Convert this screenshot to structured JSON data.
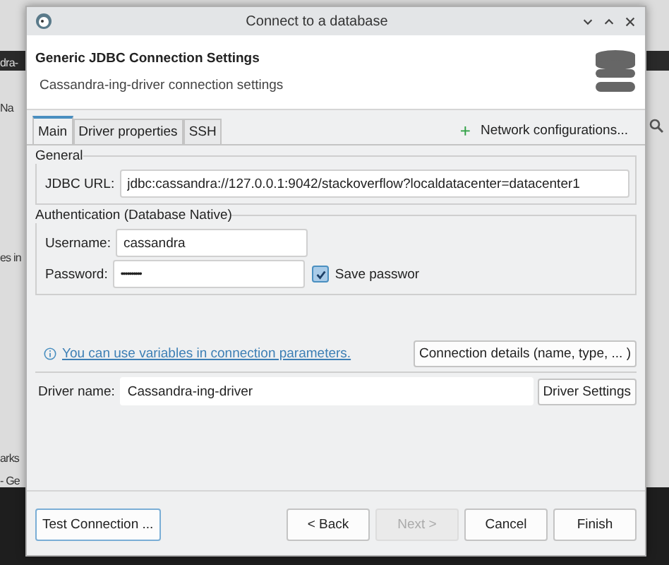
{
  "background": {
    "fragments": [
      {
        "text": "dra-",
        "kind": "dark"
      },
      {
        "text": "Na",
        "kind": "light"
      },
      {
        "text": "es in",
        "kind": "light"
      },
      {
        "text": "arks",
        "kind": "light"
      },
      {
        "text": "- Ge",
        "kind": "light"
      }
    ]
  },
  "window": {
    "title": "Connect to a database"
  },
  "header": {
    "title": "Generic JDBC Connection Settings",
    "subtitle": "Cassandra-ing-driver connection settings"
  },
  "tabs": [
    {
      "label": "Main",
      "selected": true
    },
    {
      "label": "Driver properties",
      "selected": false
    },
    {
      "label": "SSH",
      "selected": false
    }
  ],
  "network_button": {
    "icon": "+",
    "label": "Network configurations..."
  },
  "general": {
    "legend": "General",
    "url_label": "JDBC URL:",
    "url": "jdbc:cassandra://127.0.0.1:9042/stackoverflow?localdatacenter=datacenter1"
  },
  "auth": {
    "legend": "Authentication (Database Native)",
    "username_label": "Username:",
    "username": "cassandra",
    "password_label": "Password:",
    "password": "••••••••••",
    "save_password": {
      "label": "Save passwor",
      "checked": true
    }
  },
  "info_link": "You can use variables in connection parameters.",
  "details_button": "Connection details (name, type, ... )",
  "driver": {
    "label": "Driver name:",
    "value": "Cassandra-ing-driver",
    "button": "Driver Settings"
  },
  "footer": [
    {
      "label": "Test Connection ...",
      "disabled": false,
      "kind": "left"
    },
    {
      "label": "< Back",
      "disabled": false,
      "kind": "right"
    },
    {
      "label": "Next >",
      "disabled": true,
      "kind": "right"
    },
    {
      "label": "Cancel",
      "disabled": false,
      "kind": "right"
    },
    {
      "label": "Finish",
      "disabled": false,
      "kind": "right"
    }
  ]
}
